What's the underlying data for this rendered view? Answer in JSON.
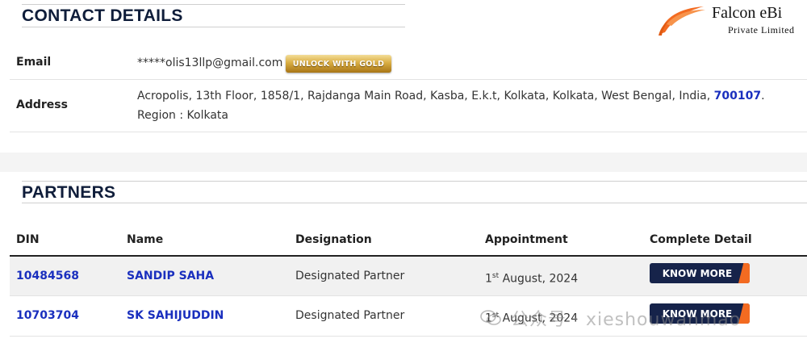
{
  "contact": {
    "title": "CONTACT DETAILS",
    "email_label": "Email",
    "email_value": "*****olis13llp@gmail.com",
    "unlock_button": "UNLOCK WITH GOLD",
    "address_label": "Address",
    "address_text": "Acropolis, 13th Floor, 1858/1, Rajdanga Main Road, Kasba, E.k.t, Kolkata, Kolkata, West Bengal, India, ",
    "pincode": "700107",
    "address_end": ".",
    "region": "Region : Kolkata"
  },
  "logo": {
    "name": "Falcon eBi",
    "subtitle": "Private Limited",
    "icon": "falcon-wing-icon"
  },
  "partners": {
    "title": "PARTNERS",
    "headers": {
      "din": "DIN",
      "name": "Name",
      "designation": "Designation",
      "appointment": "Appointment",
      "detail": "Complete Detail"
    },
    "rows": [
      {
        "din": "10484568",
        "name": "SANDIP SAHA",
        "designation": "Designated Partner",
        "day": "1",
        "suffix": "st",
        "date_rest": " August, 2024",
        "button": "KNOW MORE"
      },
      {
        "din": "10703704",
        "name": "SK SAHIJUDDIN",
        "designation": "Designated Partner",
        "day": "1",
        "suffix": "st",
        "date_rest": " August, 2024",
        "button": "KNOW MORE"
      }
    ]
  },
  "watermark": {
    "text": "公众号 · xieshouwanmao",
    "icon": "wechat-icon"
  },
  "colors": {
    "heading": "#0f1d3a",
    "link": "#1a2fbe",
    "button_dark": "#16234a",
    "button_accent": "#f36b21",
    "gold": "#d9ad42"
  }
}
